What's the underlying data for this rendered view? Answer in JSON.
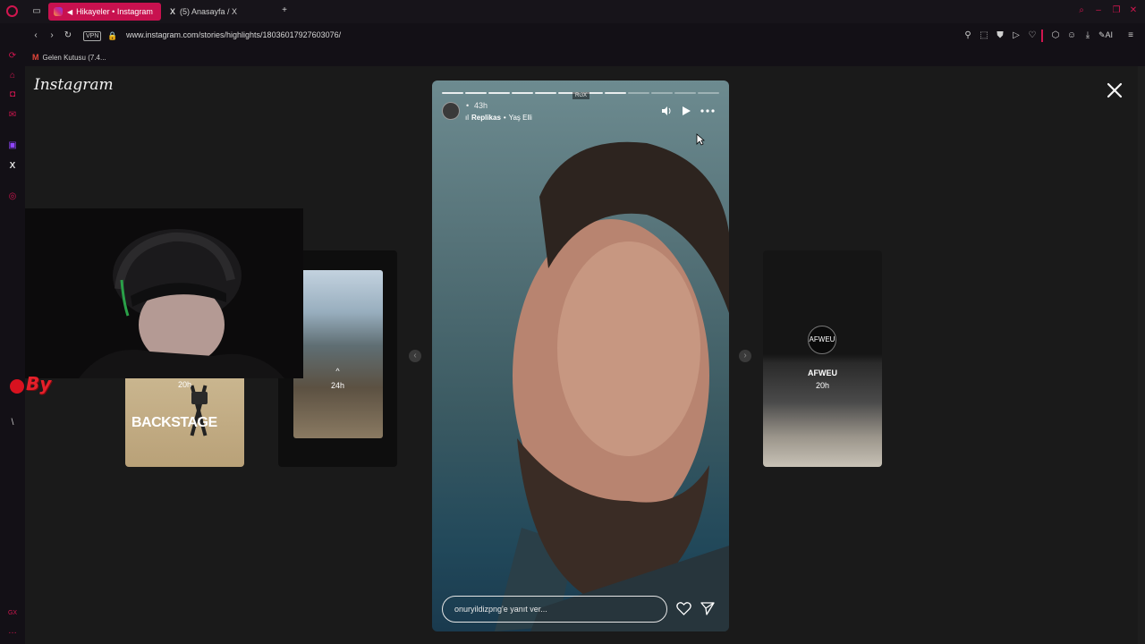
{
  "browser": {
    "tabs": [
      {
        "label": "Hikayeler • Instagram",
        "active": true
      },
      {
        "label": "(5) Anasayfa / X",
        "active": false
      }
    ],
    "new_tab_label": "+",
    "vpn_label": "VPN",
    "url": "www.instagram.com/stories/highlights/18036017927603076/",
    "ai_label": "AI",
    "bookmark": "Gelen Kutusu (7.4...",
    "sidebar_gx": "GX"
  },
  "instagram": {
    "logo": "Instagram"
  },
  "story": {
    "time": "43h",
    "bullet": "•",
    "music_artist": "Replikas",
    "music_sep": "•",
    "music_song": "Yaş Elli",
    "badge": "RGX",
    "reply_placeholder": "onuryildizpng'e yanıt ver...",
    "progress_segments": 12,
    "progress_filled": 8
  },
  "side_stories": [
    {
      "label": "BACKSTAGE",
      "time": "20h"
    },
    {
      "label": "^",
      "time": "24h"
    },
    {
      "label": "AFWEU",
      "time": "20h",
      "logo": "AFWEU"
    }
  ],
  "overlay": {
    "webcam_logo": "By",
    "sidebar_mark": "\\"
  },
  "colors": {
    "accent": "#d0164f",
    "tab_active": "#c8114f"
  }
}
